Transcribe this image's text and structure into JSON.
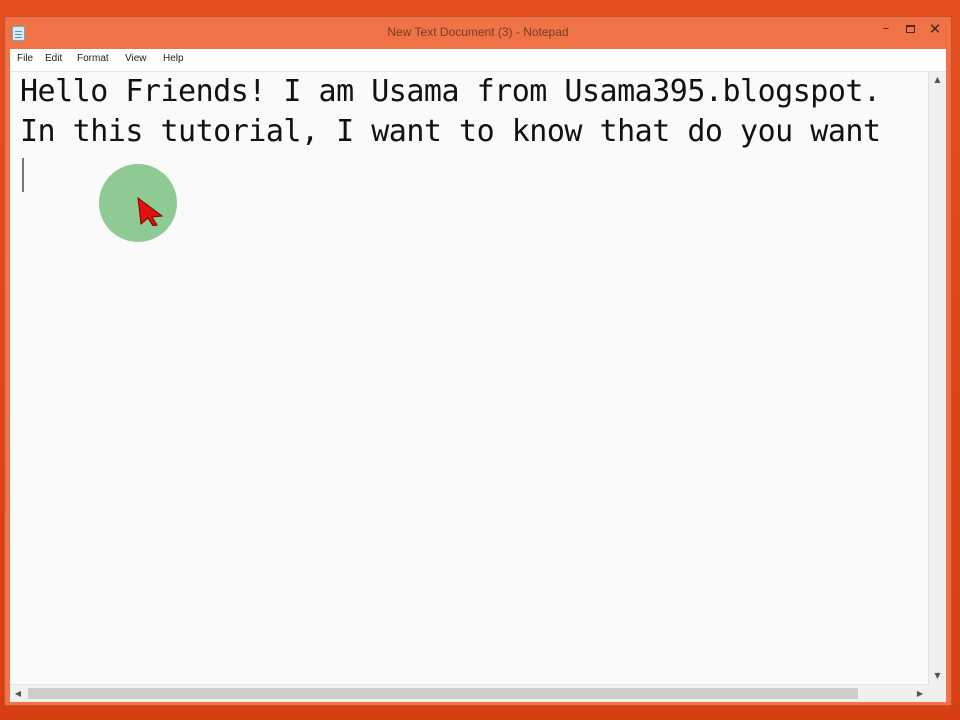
{
  "window": {
    "title": "New Text Document (3) - Notepad",
    "minimize_glyph": "–",
    "close_glyph": "✕"
  },
  "menu": {
    "items": [
      "File",
      "Edit",
      "Format",
      "View",
      "Help"
    ]
  },
  "editor": {
    "lines": [
      "Hello Friends! I am Usama from Usama395.blogspot.",
      "In this tutorial, I want to know that do you want"
    ]
  },
  "icons": {
    "app": "notepad-icon",
    "pointer": "mouse-pointer-icon",
    "scroll_up": "▲",
    "scroll_down": "▼",
    "scroll_left": "◀",
    "scroll_right": "▶"
  },
  "colors": {
    "desktop": "#e0471b",
    "titlebar": "#f07347",
    "cursor_halo": "#85c48a",
    "pointer": "#e01010"
  }
}
